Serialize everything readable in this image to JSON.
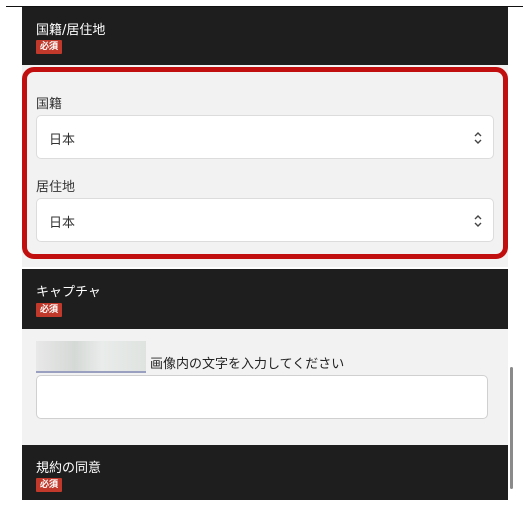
{
  "nationality_section": {
    "title": "国籍/居住地",
    "required_badge": "必須",
    "nationality_label": "国籍",
    "nationality_value": "日本",
    "residence_label": "居住地",
    "residence_value": "日本"
  },
  "captcha_section": {
    "title": "キャプチャ",
    "required_badge": "必須",
    "instruction": "画像内の文字を入力してください",
    "input_value": ""
  },
  "terms_section": {
    "title": "規約の同意",
    "required_badge": "必須"
  },
  "colors": {
    "header_bg": "#1e1e1e",
    "badge_red": "#c0392b",
    "highlight_red": "#c10e0e",
    "form_bg": "#f2f2f2"
  },
  "icons": {
    "select_arrow": "chevron-up-down-icon"
  }
}
